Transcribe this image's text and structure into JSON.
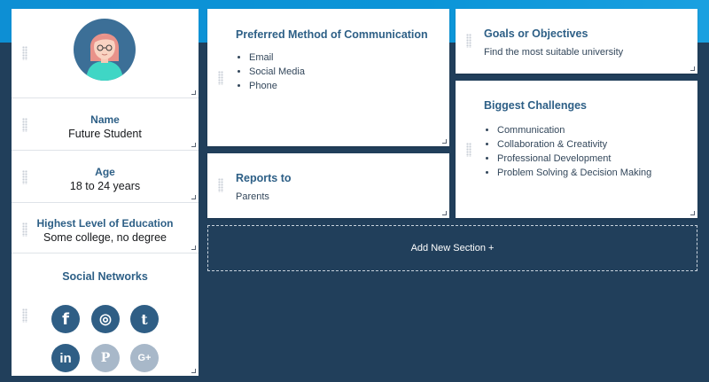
{
  "persona": {
    "name_label": "Name",
    "name_value": "Future Student",
    "age_label": "Age",
    "age_value": "18 to 24 years",
    "education_label": "Highest Level of Education",
    "education_value": "Some college, no degree",
    "social_title": "Social Networks",
    "social_icons": [
      {
        "icon": "facebook-icon",
        "glyph": "f",
        "active": true
      },
      {
        "icon": "instagram-icon",
        "glyph": "◎",
        "active": true
      },
      {
        "icon": "twitter-icon",
        "glyph": "t",
        "active": true
      },
      {
        "icon": "linkedin-icon",
        "glyph": "in",
        "active": true
      },
      {
        "icon": "pinterest-icon",
        "glyph": "P",
        "active": false
      },
      {
        "icon": "google-plus-icon",
        "glyph": "G+",
        "active": false
      }
    ]
  },
  "sections": {
    "communication": {
      "title": "Preferred Method of Communication",
      "items": [
        "Email",
        "Social Media",
        "Phone"
      ]
    },
    "goals": {
      "title": "Goals or Objectives",
      "text": "Find the most suitable university"
    },
    "reports": {
      "title": "Reports to",
      "text": "Parents"
    },
    "challenges": {
      "title": "Biggest Challenges",
      "items": [
        "Communication",
        "Collaboration & Creativity",
        "Professional Development",
        "Problem Solving & Decision Making"
      ]
    }
  },
  "add_section_label": "Add New Section +",
  "colors": {
    "accent": "#2d5f86",
    "background": "#213f5b",
    "header_band": "#0d8fd4",
    "social_active": "#2f5e85",
    "social_inactive": "#a8b8c9"
  }
}
